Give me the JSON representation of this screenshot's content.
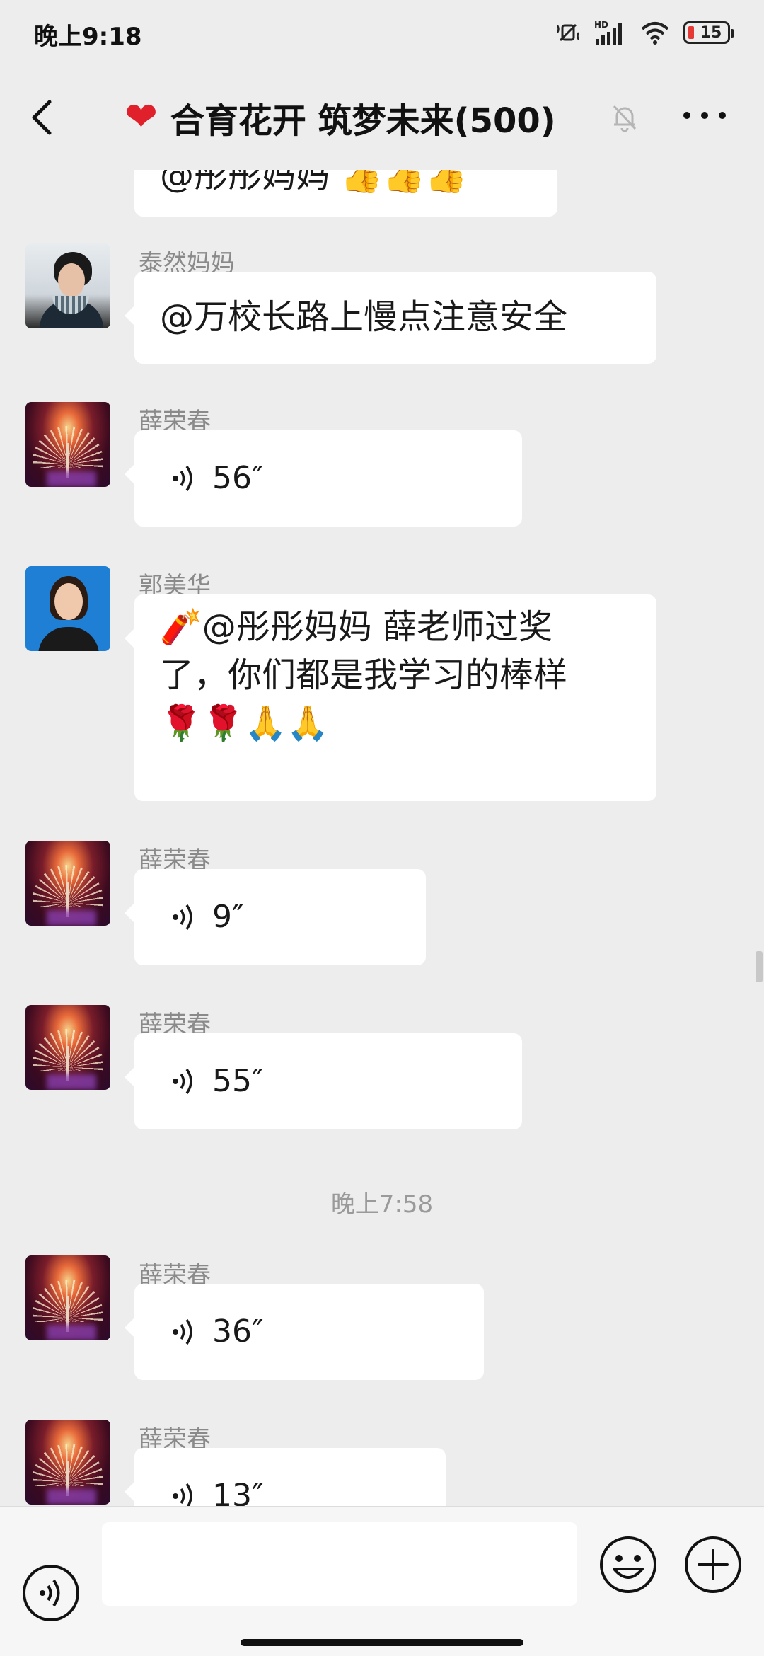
{
  "status_bar": {
    "time": "晚上9:18",
    "battery": "15",
    "icons": [
      "mute-icon",
      "hd-signal-icon",
      "wifi-icon",
      "battery-icon"
    ]
  },
  "nav": {
    "title": "合育花开 筑梦未来(500)",
    "heart": "❤",
    "icons": [
      "back-icon",
      "heart-emoji",
      "muted-bell-icon",
      "more-icon"
    ]
  },
  "messages": [
    {
      "type": "partial",
      "text": "@彤彤妈妈 👍👍👍"
    },
    {
      "sender": "泰然妈妈",
      "type": "text",
      "text": "@万校长路上慢点注意安全"
    },
    {
      "sender": "薛荣春",
      "type": "voice",
      "duration": "56″"
    },
    {
      "sender": "郭美华",
      "type": "text",
      "text_line1": "🧨@彤彤妈妈  薛老师过奖",
      "text_line2": "了，你们都是我学习的棒样",
      "text_line3": "🌹🌹🙏🙏"
    },
    {
      "sender": "薛荣春",
      "type": "voice",
      "duration": "9″"
    },
    {
      "sender": "薛荣春",
      "type": "voice",
      "duration": "55″"
    },
    {
      "type": "time",
      "text": "晚上7:58"
    },
    {
      "sender": "薛荣春",
      "type": "voice",
      "duration": "36″"
    },
    {
      "sender": "薛荣春",
      "type": "voice",
      "duration": "13″"
    }
  ],
  "input_bar": {
    "placeholder": "",
    "icons": [
      "voice-toggle-icon",
      "emoji-icon",
      "plus-icon"
    ]
  },
  "colors": {
    "background": "#ededed",
    "bubble": "#ffffff",
    "sender_name": "#8a8a8a",
    "timestamp": "#9a9a9a"
  }
}
